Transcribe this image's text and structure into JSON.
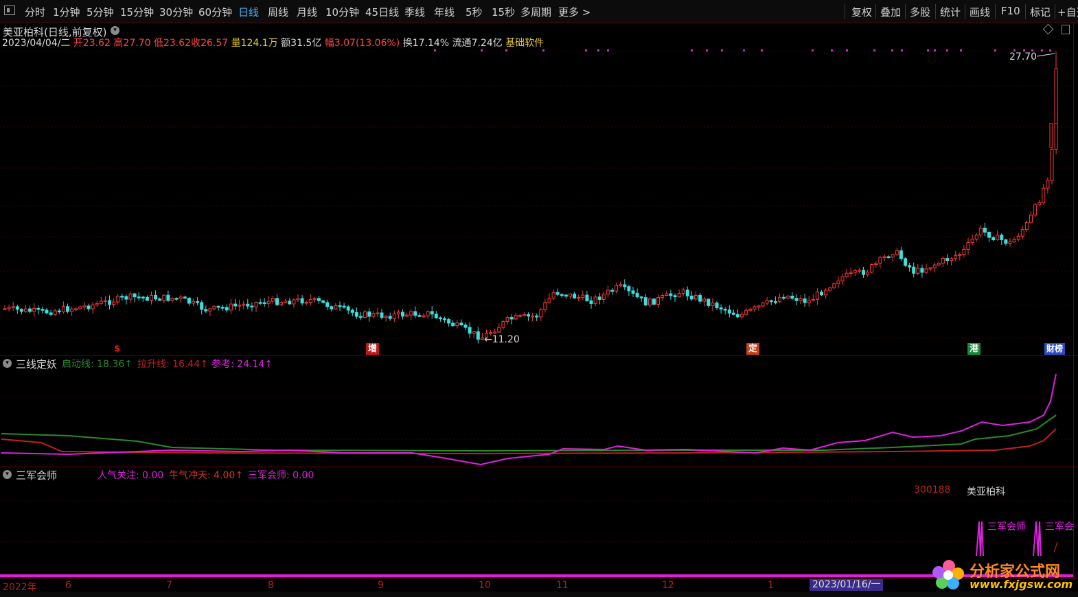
{
  "toolbar": {
    "periods": [
      "分时",
      "1分钟",
      "5分钟",
      "15分钟",
      "30分钟",
      "60分钟",
      "日线",
      "周线",
      "月线",
      "10分钟",
      "45日线",
      "季线",
      "年线",
      "5秒",
      "15秒",
      "多周期",
      "更多 >"
    ],
    "active_period": "日线",
    "tools": [
      "复权",
      "叠加",
      "多股",
      "统计",
      "画线",
      "F10",
      "标记",
      "+自选"
    ]
  },
  "stock": {
    "title": "美亚柏科(日线,前复权)",
    "date": "2023/04/04/二",
    "open_label": "开",
    "open": "23.62",
    "high_label": "高",
    "high": "27.70",
    "low_label": "低",
    "low": "23.62",
    "close_label": "收",
    "close": "26.57",
    "vol_label": "量",
    "vol": "124.1万",
    "amount_label": "额",
    "amount": "31.5亿",
    "change_label": "幅",
    "change": "3.07(13.06%)",
    "turnover_label": "换",
    "turnover": "17.14%",
    "float_label": "流通",
    "float": "7.24亿",
    "sector": "基础软件",
    "high_marker": "27.70",
    "low_marker": "11.20"
  },
  "badges": [
    {
      "text": "$",
      "color": "#d02020"
    },
    {
      "text": "增",
      "color": "#d02020"
    },
    {
      "text": "定",
      "color": "#d04020"
    },
    {
      "text": "港",
      "color": "#1a9a3a"
    },
    {
      "text": "财榜",
      "color": "#3a5ad0"
    }
  ],
  "indicator1": {
    "name": "三线定妖",
    "line1_label": "启动线: 18.36↑",
    "line1_color": "#2a8a2a",
    "line2_label": "拉升线: 16.44↑",
    "line2_color": "#c02020",
    "line3_label": "参考: 24.14↑",
    "line3_color": "#e020e0"
  },
  "indicator2": {
    "name": "三军会师",
    "v1_label": "人气关注: 0.00",
    "v1_color": "#e020e0",
    "v2_label": "牛气冲天: 4.00↑",
    "v2_color": "#e03030",
    "v3_label": "三军会师: 0.00",
    "v3_color": "#e020e0",
    "code": "300188",
    "code_name": "美亚柏科",
    "signal_text": "三军会师",
    "signal_text_cut": "三军会"
  },
  "xaxis": {
    "year": "2022年",
    "months": [
      "6",
      "7",
      "8",
      "9",
      "10",
      "11",
      "12",
      "1"
    ],
    "cursor_date": "2023/01/16/一"
  },
  "logo": {
    "line1": "分析家公式网",
    "line2": "www.fxjgsw.com"
  },
  "colors": {
    "up": "#ff3a3a",
    "down": "#38e0e0",
    "grid": "#6a0000",
    "active": "#49b6ff"
  }
}
